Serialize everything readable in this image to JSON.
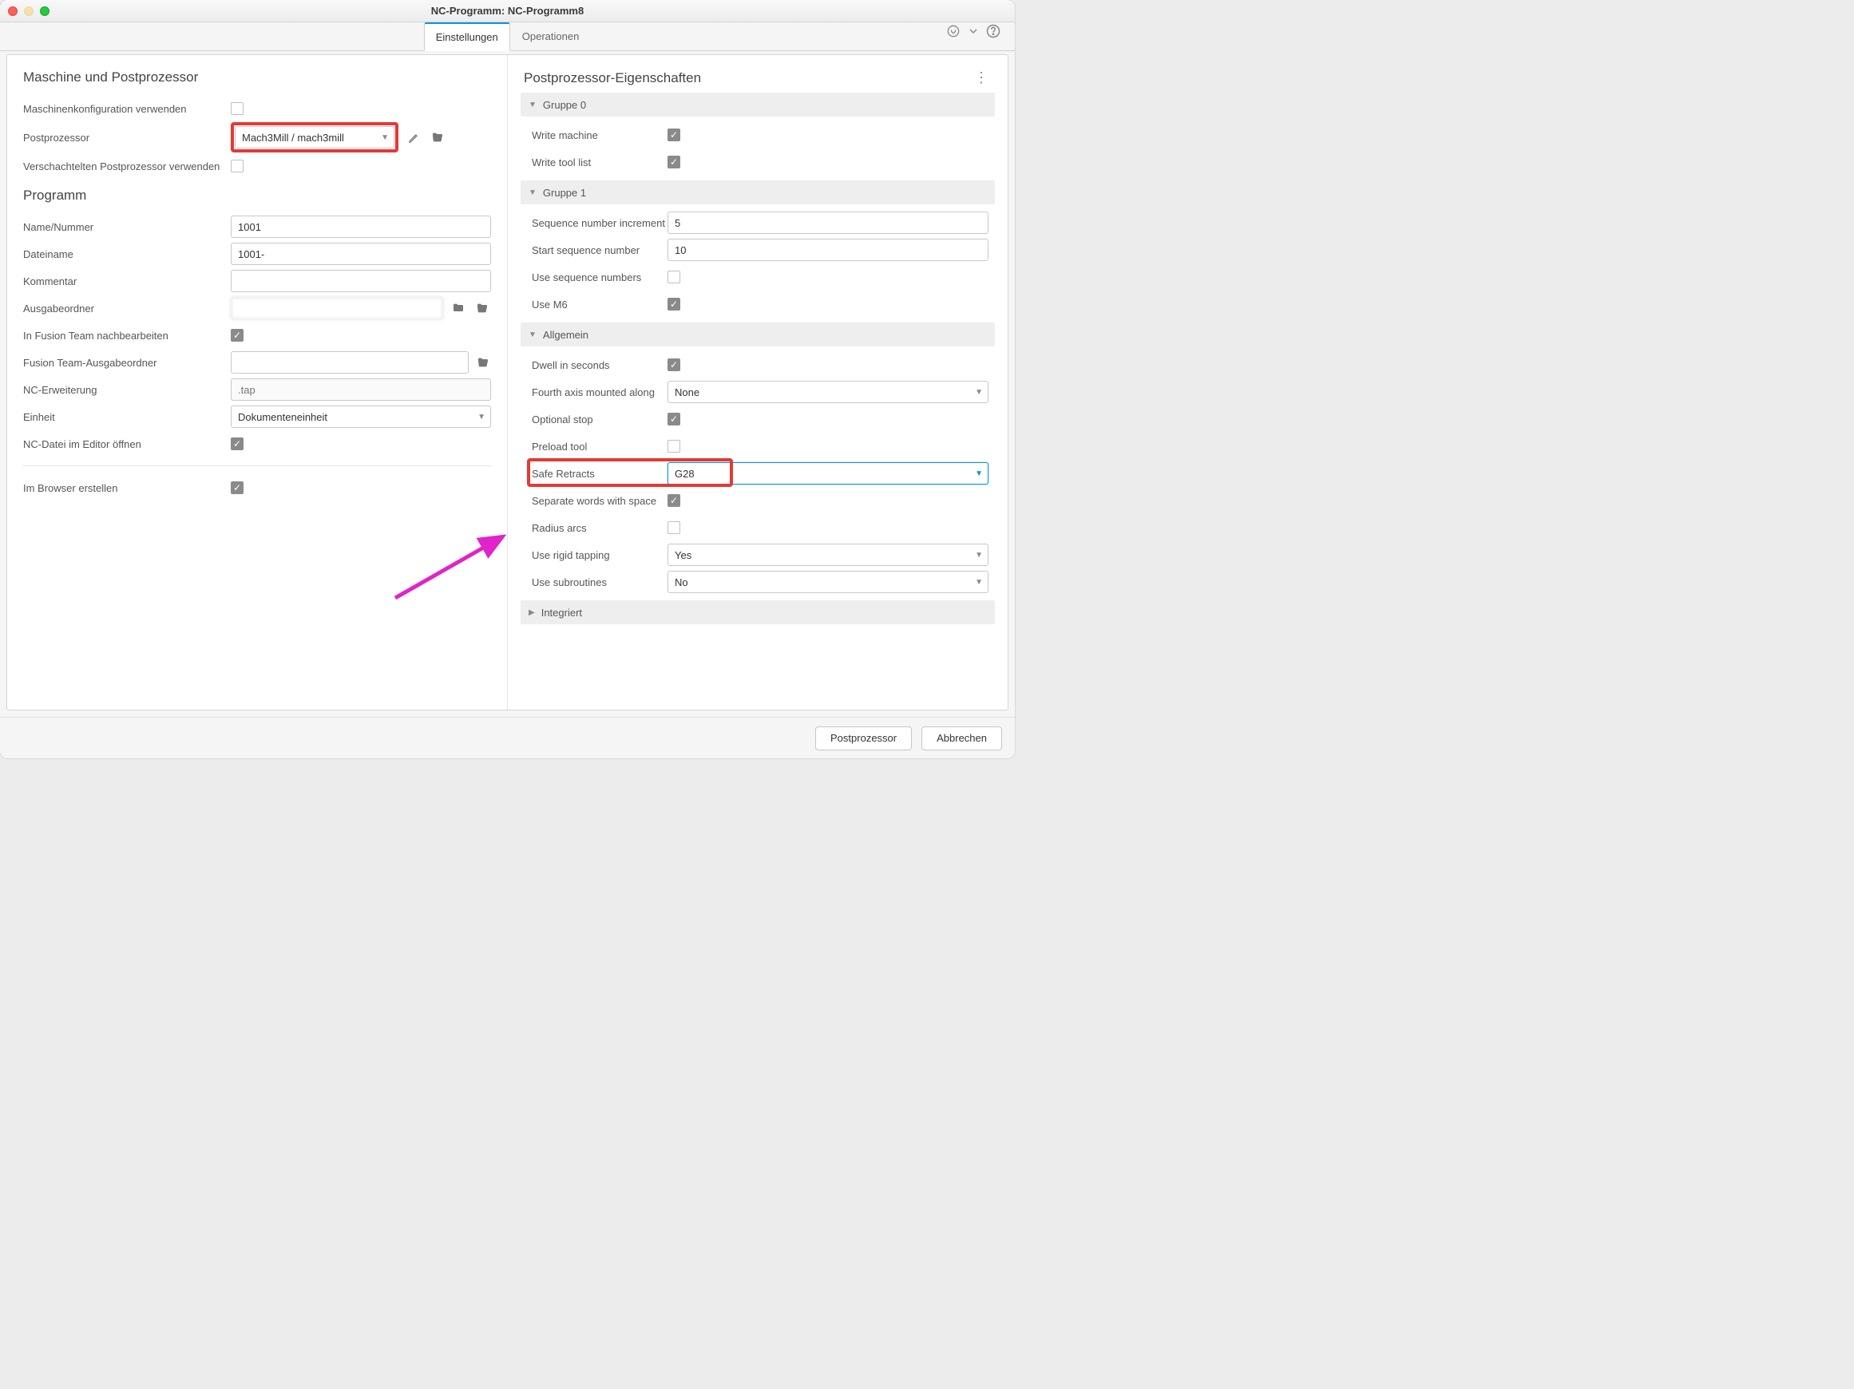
{
  "window": {
    "title": "NC-Programm: NC-Programm8"
  },
  "tabs": {
    "settings": "Einstellungen",
    "operations": "Operationen"
  },
  "left": {
    "section1_title": "Maschine und Postprozessor",
    "use_machine_config": "Maschinenkonfiguration verwenden",
    "postprocessor_label": "Postprozessor",
    "postprocessor_value": "Mach3Mill / mach3mill",
    "use_nested_pp": "Verschachtelten Postprozessor verwenden",
    "section2_title": "Programm",
    "name_number_label": "Name/Nummer",
    "name_number_value": "1001",
    "filename_label": "Dateiname",
    "filename_value": "1001-",
    "comment_label": "Kommentar",
    "comment_value": "",
    "output_folder_label": "Ausgabeordner",
    "output_folder_value": "",
    "edit_in_team_label": "In Fusion Team nachbearbeiten",
    "team_output_label": "Fusion Team-Ausgabeordner",
    "team_output_value": "",
    "nc_ext_label": "NC-Erweiterung",
    "nc_ext_placeholder": ".tap",
    "unit_label": "Einheit",
    "unit_value": "Dokumenteneinheit",
    "open_in_editor_label": "NC-Datei im Editor öffnen",
    "create_in_browser_label": "Im Browser erstellen"
  },
  "right": {
    "title": "Postprozessor-Eigenschaften",
    "group0": "Gruppe 0",
    "write_machine": "Write machine",
    "write_tool_list": "Write tool list",
    "group1": "Gruppe 1",
    "seq_inc_label": "Sequence number increment",
    "seq_inc_value": "5",
    "start_seq_label": "Start sequence number",
    "start_seq_value": "10",
    "use_seq_label": "Use sequence numbers",
    "use_m6_label": "Use M6",
    "group_general": "Allgemein",
    "dwell_label": "Dwell in seconds",
    "fourth_axis_label": "Fourth axis mounted along",
    "fourth_axis_value": "None",
    "optional_stop_label": "Optional stop",
    "preload_tool_label": "Preload tool",
    "safe_retracts_label": "Safe Retracts",
    "safe_retracts_value": "G28",
    "sep_words_label": "Separate words with space",
    "radius_arcs_label": "Radius arcs",
    "rigid_tap_label": "Use rigid tapping",
    "rigid_tap_value": "Yes",
    "subroutines_label": "Use subroutines",
    "subroutines_value": "No",
    "group_integrated": "Integriert"
  },
  "footer": {
    "post": "Postprozessor",
    "cancel": "Abbrechen"
  }
}
